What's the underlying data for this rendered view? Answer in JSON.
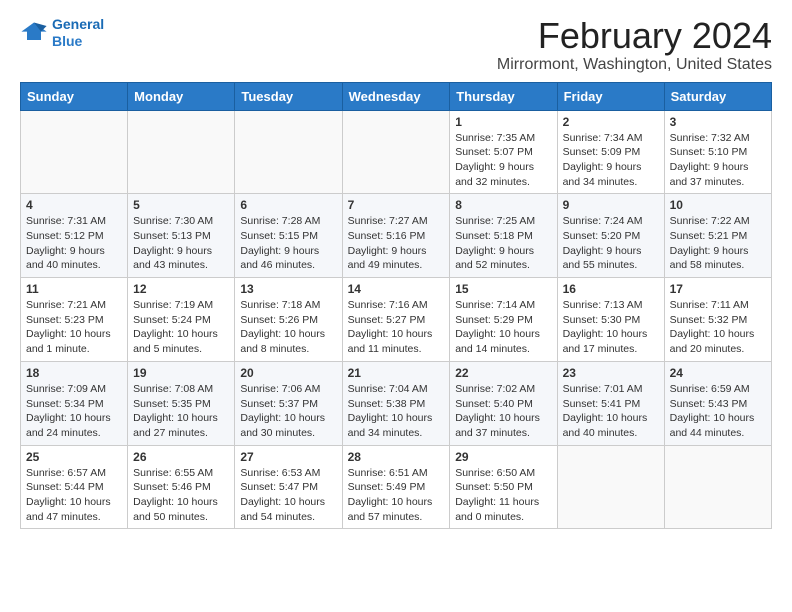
{
  "header": {
    "logo_line1": "General",
    "logo_line2": "Blue",
    "title": "February 2024",
    "subtitle": "Mirrormont, Washington, United States"
  },
  "calendar": {
    "days_of_week": [
      "Sunday",
      "Monday",
      "Tuesday",
      "Wednesday",
      "Thursday",
      "Friday",
      "Saturday"
    ],
    "rows": [
      [
        {
          "day": "",
          "info": ""
        },
        {
          "day": "",
          "info": ""
        },
        {
          "day": "",
          "info": ""
        },
        {
          "day": "",
          "info": ""
        },
        {
          "day": "1",
          "info": "Sunrise: 7:35 AM\nSunset: 5:07 PM\nDaylight: 9 hours and 32 minutes."
        },
        {
          "day": "2",
          "info": "Sunrise: 7:34 AM\nSunset: 5:09 PM\nDaylight: 9 hours and 34 minutes."
        },
        {
          "day": "3",
          "info": "Sunrise: 7:32 AM\nSunset: 5:10 PM\nDaylight: 9 hours and 37 minutes."
        }
      ],
      [
        {
          "day": "4",
          "info": "Sunrise: 7:31 AM\nSunset: 5:12 PM\nDaylight: 9 hours and 40 minutes."
        },
        {
          "day": "5",
          "info": "Sunrise: 7:30 AM\nSunset: 5:13 PM\nDaylight: 9 hours and 43 minutes."
        },
        {
          "day": "6",
          "info": "Sunrise: 7:28 AM\nSunset: 5:15 PM\nDaylight: 9 hours and 46 minutes."
        },
        {
          "day": "7",
          "info": "Sunrise: 7:27 AM\nSunset: 5:16 PM\nDaylight: 9 hours and 49 minutes."
        },
        {
          "day": "8",
          "info": "Sunrise: 7:25 AM\nSunset: 5:18 PM\nDaylight: 9 hours and 52 minutes."
        },
        {
          "day": "9",
          "info": "Sunrise: 7:24 AM\nSunset: 5:20 PM\nDaylight: 9 hours and 55 minutes."
        },
        {
          "day": "10",
          "info": "Sunrise: 7:22 AM\nSunset: 5:21 PM\nDaylight: 9 hours and 58 minutes."
        }
      ],
      [
        {
          "day": "11",
          "info": "Sunrise: 7:21 AM\nSunset: 5:23 PM\nDaylight: 10 hours and 1 minute."
        },
        {
          "day": "12",
          "info": "Sunrise: 7:19 AM\nSunset: 5:24 PM\nDaylight: 10 hours and 5 minutes."
        },
        {
          "day": "13",
          "info": "Sunrise: 7:18 AM\nSunset: 5:26 PM\nDaylight: 10 hours and 8 minutes."
        },
        {
          "day": "14",
          "info": "Sunrise: 7:16 AM\nSunset: 5:27 PM\nDaylight: 10 hours and 11 minutes."
        },
        {
          "day": "15",
          "info": "Sunrise: 7:14 AM\nSunset: 5:29 PM\nDaylight: 10 hours and 14 minutes."
        },
        {
          "day": "16",
          "info": "Sunrise: 7:13 AM\nSunset: 5:30 PM\nDaylight: 10 hours and 17 minutes."
        },
        {
          "day": "17",
          "info": "Sunrise: 7:11 AM\nSunset: 5:32 PM\nDaylight: 10 hours and 20 minutes."
        }
      ],
      [
        {
          "day": "18",
          "info": "Sunrise: 7:09 AM\nSunset: 5:34 PM\nDaylight: 10 hours and 24 minutes."
        },
        {
          "day": "19",
          "info": "Sunrise: 7:08 AM\nSunset: 5:35 PM\nDaylight: 10 hours and 27 minutes."
        },
        {
          "day": "20",
          "info": "Sunrise: 7:06 AM\nSunset: 5:37 PM\nDaylight: 10 hours and 30 minutes."
        },
        {
          "day": "21",
          "info": "Sunrise: 7:04 AM\nSunset: 5:38 PM\nDaylight: 10 hours and 34 minutes."
        },
        {
          "day": "22",
          "info": "Sunrise: 7:02 AM\nSunset: 5:40 PM\nDaylight: 10 hours and 37 minutes."
        },
        {
          "day": "23",
          "info": "Sunrise: 7:01 AM\nSunset: 5:41 PM\nDaylight: 10 hours and 40 minutes."
        },
        {
          "day": "24",
          "info": "Sunrise: 6:59 AM\nSunset: 5:43 PM\nDaylight: 10 hours and 44 minutes."
        }
      ],
      [
        {
          "day": "25",
          "info": "Sunrise: 6:57 AM\nSunset: 5:44 PM\nDaylight: 10 hours and 47 minutes."
        },
        {
          "day": "26",
          "info": "Sunrise: 6:55 AM\nSunset: 5:46 PM\nDaylight: 10 hours and 50 minutes."
        },
        {
          "day": "27",
          "info": "Sunrise: 6:53 AM\nSunset: 5:47 PM\nDaylight: 10 hours and 54 minutes."
        },
        {
          "day": "28",
          "info": "Sunrise: 6:51 AM\nSunset: 5:49 PM\nDaylight: 10 hours and 57 minutes."
        },
        {
          "day": "29",
          "info": "Sunrise: 6:50 AM\nSunset: 5:50 PM\nDaylight: 11 hours and 0 minutes."
        },
        {
          "day": "",
          "info": ""
        },
        {
          "day": "",
          "info": ""
        }
      ]
    ]
  }
}
